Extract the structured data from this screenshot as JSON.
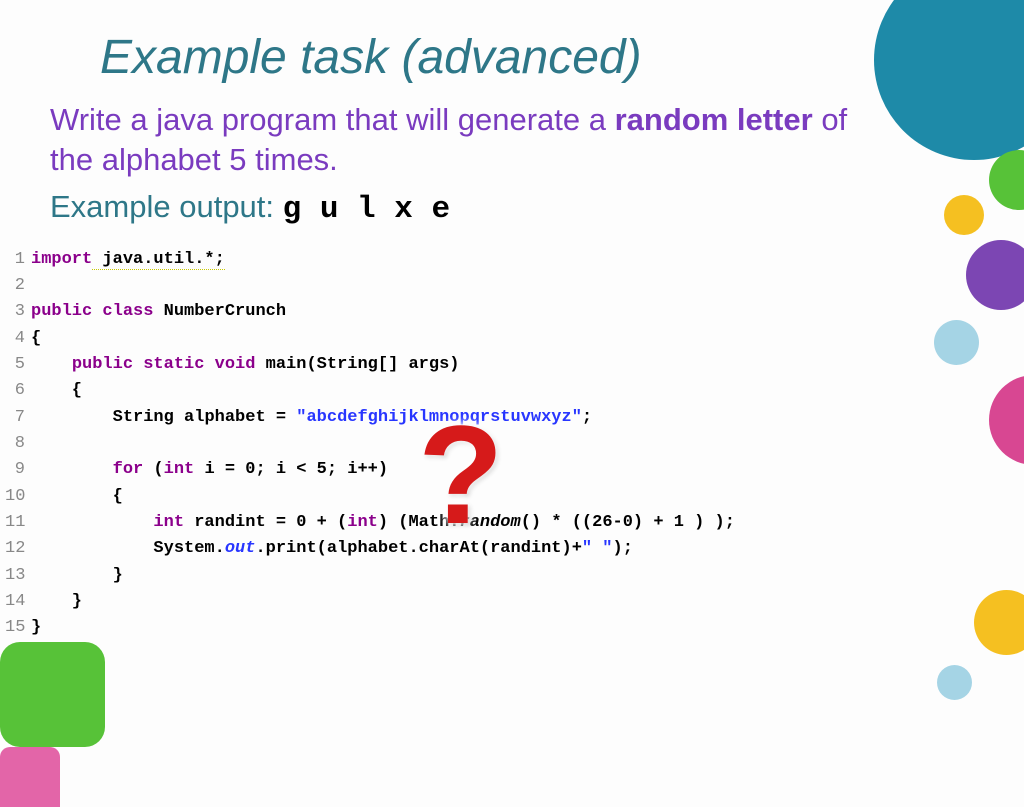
{
  "title": "Example task (advanced)",
  "prompt_pre": "Write a java program that will generate a ",
  "prompt_bold": "random letter",
  "prompt_post": " of the alphabet 5 times.",
  "output_label": "Example output: ",
  "output_value": "g u l x e",
  "qmark": "?",
  "code": {
    "l1": {
      "kw": "import",
      "rest": " java.util.*;"
    },
    "l3": {
      "kw": "public class ",
      "cls": "NumberCrunch"
    },
    "l4": "{",
    "l5": {
      "pad": "    ",
      "kw1": "public static void",
      "mid": " main(String[] args)"
    },
    "l6": "    {",
    "l7": {
      "pad": "        ",
      "type": "String alphabet = ",
      "str": "\"abcdefghijklmnopqrstuvwxyz\"",
      "end": ";"
    },
    "l9": {
      "pad": "        ",
      "kw1": "for",
      "a": " (",
      "kw2": "int",
      "b": " i = 0; i < 5; i++)"
    },
    "l10": "        {",
    "l11": {
      "pad": "            ",
      "kw1": "int",
      "a": " randint = 0 + (",
      "kw2": "int",
      "b": ") (Math.",
      "m": "random",
      "c": "() * ((26-0) + 1 ) );"
    },
    "l12": {
      "pad": "            ",
      "a": "System.",
      "f": "out",
      "b": ".print(alphabet.charAt(randint)+",
      "str": "\" \"",
      "c": ");"
    },
    "l13": "        }",
    "l14": "    }",
    "l15": "}"
  }
}
